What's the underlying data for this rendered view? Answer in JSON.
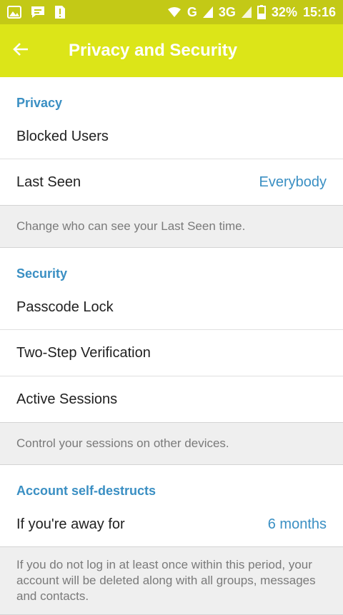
{
  "status_bar": {
    "left_icons": [
      "image-icon",
      "chat-icon",
      "alert-icon"
    ],
    "right_icons": [
      "wifi-icon",
      "signal-icon",
      "signal-3g-icon",
      "battery-icon"
    ],
    "network_g": "G",
    "network_3g": "3G",
    "battery": "32%",
    "time": "15:16"
  },
  "app_bar": {
    "title": "Privacy and Security",
    "back_icon": "arrow-left-icon"
  },
  "privacy": {
    "header": "Privacy",
    "blocked_users": "Blocked Users",
    "last_seen": "Last Seen",
    "last_seen_value": "Everybody",
    "info": "Change who can see your Last Seen time."
  },
  "security": {
    "header": "Security",
    "passcode": "Passcode Lock",
    "two_step": "Two-Step Verification",
    "sessions": "Active Sessions",
    "info": "Control your sessions on other devices."
  },
  "self_destruct": {
    "header": "Account self-destructs",
    "away_for": "If you're away for",
    "away_value": "6 months",
    "info": "If you do not log in at least once within this period, your account will be deleted along with all groups, messages and contacts."
  },
  "colors": {
    "status_bar": "#c3c916",
    "app_bar": "#dce518",
    "accent": "#3a8fc3",
    "info_bg": "#efefef"
  }
}
